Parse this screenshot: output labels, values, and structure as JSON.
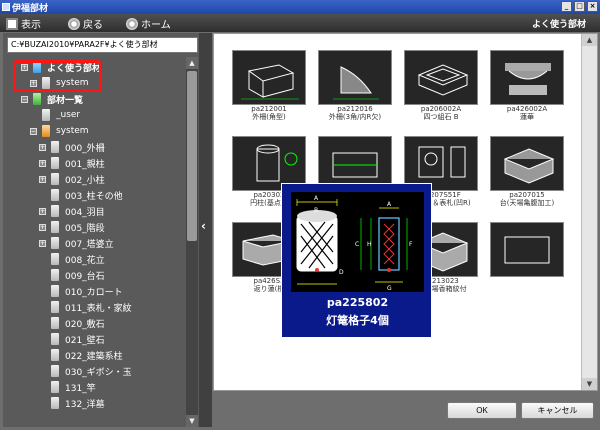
{
  "window": {
    "title": "伊福部材"
  },
  "toolbar": {
    "view": "表示",
    "back": "戻る",
    "home": "ホーム",
    "right_label": "よく使う部材"
  },
  "path": "C:¥BUZAI2010¥PARA2F¥よく使う部材",
  "tree": [
    {
      "label": "よく使う部材",
      "icon": "f-cyan",
      "expander": "+",
      "indent": 0
    },
    {
      "label": "system",
      "icon": "f-gray",
      "expander": "+",
      "indent": 1
    },
    {
      "label": "部材一覧",
      "icon": "f-green",
      "expander": "−",
      "indent": 0
    },
    {
      "label": "_user",
      "icon": "f-gray",
      "expander": "",
      "indent": 1
    },
    {
      "label": "system",
      "icon": "f-orange",
      "expander": "−",
      "indent": 1
    },
    {
      "label": "000_外柵",
      "icon": "f-gray",
      "expander": "+",
      "indent": 2
    },
    {
      "label": "001_親柱",
      "icon": "f-gray",
      "expander": "+",
      "indent": 2
    },
    {
      "label": "002_小柱",
      "icon": "f-gray",
      "expander": "+",
      "indent": 2
    },
    {
      "label": "003_柱その他",
      "icon": "f-gray",
      "expander": "",
      "indent": 2
    },
    {
      "label": "004_羽目",
      "icon": "f-gray",
      "expander": "+",
      "indent": 2
    },
    {
      "label": "005_階段",
      "icon": "f-gray",
      "expander": "+",
      "indent": 2
    },
    {
      "label": "007_塔婆立",
      "icon": "f-gray",
      "expander": "+",
      "indent": 2
    },
    {
      "label": "008_花立",
      "icon": "f-gray",
      "expander": "",
      "indent": 2
    },
    {
      "label": "009_台石",
      "icon": "f-gray",
      "expander": "",
      "indent": 2
    },
    {
      "label": "010_カロート",
      "icon": "f-gray",
      "expander": "",
      "indent": 2
    },
    {
      "label": "011_表札・家紋",
      "icon": "f-gray",
      "expander": "",
      "indent": 2
    },
    {
      "label": "020_敷石",
      "icon": "f-gray",
      "expander": "",
      "indent": 2
    },
    {
      "label": "021_壁石",
      "icon": "f-gray",
      "expander": "",
      "indent": 2
    },
    {
      "label": "022_建築系柱",
      "icon": "f-gray",
      "expander": "",
      "indent": 2
    },
    {
      "label": "030_ギボシ・玉",
      "icon": "f-gray",
      "expander": "",
      "indent": 2
    },
    {
      "label": "131_竿",
      "icon": "f-gray",
      "expander": "",
      "indent": 2
    },
    {
      "label": "132_洋墓",
      "icon": "f-gray",
      "expander": "",
      "indent": 2
    }
  ],
  "parts": [
    {
      "code": "pa212001",
      "name": "外柵(角型)"
    },
    {
      "code": "pa212016",
      "name": "外柵(3角/内R欠)"
    },
    {
      "code": "pa206002A",
      "name": "四つ組石 B"
    },
    {
      "code": "pa426002A",
      "name": "蓮華"
    },
    {
      "code": "pa20302",
      "name": "円柱(基点前"
    },
    {
      "code": "",
      "name": ""
    },
    {
      "code": "pa207S51F",
      "name": "応家紋＆表札(凹R)"
    },
    {
      "code": "pa207015",
      "name": "台(天場亀腹加工)"
    },
    {
      "code": "pa426S3",
      "name": "返り蓮(樹"
    },
    {
      "code": "",
      "name": ""
    },
    {
      "code": "pa213023",
      "name": "台/天場香箱紋付"
    },
    {
      "code": "",
      "name": ""
    }
  ],
  "popup": {
    "code": "pa225802",
    "name": "灯篭格子4個"
  },
  "buttons": {
    "ok": "OK",
    "cancel": "キャンセル"
  }
}
